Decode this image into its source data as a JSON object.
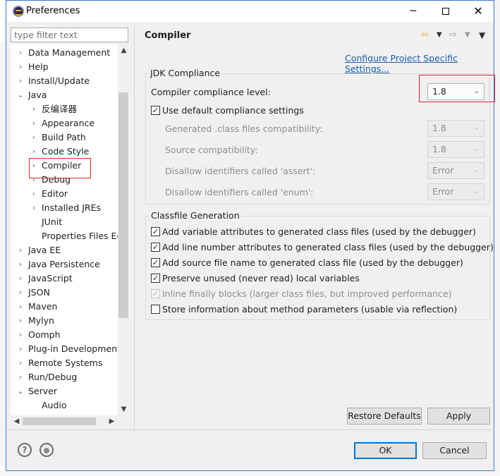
{
  "window": {
    "title": "Preferences",
    "controls": {
      "minimize": "─",
      "close": "✕"
    }
  },
  "filter": {
    "placeholder": "type filter text"
  },
  "tree": {
    "items": [
      {
        "label": "Data Management",
        "expander": "›",
        "level": 0
      },
      {
        "label": "Help",
        "expander": "›",
        "level": 0
      },
      {
        "label": "Install/Update",
        "expander": "›",
        "level": 0
      },
      {
        "label": "Java",
        "expander": "⌄",
        "level": 0
      },
      {
        "label": "反编译器",
        "expander": "›",
        "level": 1
      },
      {
        "label": "Appearance",
        "expander": "›",
        "level": 1
      },
      {
        "label": "Build Path",
        "expander": "›",
        "level": 1
      },
      {
        "label": "Code Style",
        "expander": "›",
        "level": 1
      },
      {
        "label": "Compiler",
        "expander": "›",
        "level": 1,
        "selected": true
      },
      {
        "label": "Debug",
        "expander": "›",
        "level": 1
      },
      {
        "label": "Editor",
        "expander": "›",
        "level": 1
      },
      {
        "label": "Installed JREs",
        "expander": "›",
        "level": 1
      },
      {
        "label": "JUnit",
        "expander": "",
        "level": 1
      },
      {
        "label": "Properties Files Ed",
        "expander": "",
        "level": 1
      },
      {
        "label": "Java EE",
        "expander": "›",
        "level": 0
      },
      {
        "label": "Java Persistence",
        "expander": "›",
        "level": 0
      },
      {
        "label": "JavaScript",
        "expander": "›",
        "level": 0
      },
      {
        "label": "JSON",
        "expander": "›",
        "level": 0
      },
      {
        "label": "Maven",
        "expander": "›",
        "level": 0
      },
      {
        "label": "Mylyn",
        "expander": "›",
        "level": 0
      },
      {
        "label": "Oomph",
        "expander": "›",
        "level": 0
      },
      {
        "label": "Plug-in Development",
        "expander": "›",
        "level": 0
      },
      {
        "label": "Remote Systems",
        "expander": "›",
        "level": 0
      },
      {
        "label": "Run/Debug",
        "expander": "›",
        "level": 0
      },
      {
        "label": "Server",
        "expander": "⌄",
        "level": 0
      },
      {
        "label": "Audio",
        "expander": "",
        "level": 1
      }
    ]
  },
  "page": {
    "title": "Compiler",
    "configure_link": "Configure Project Specific Settings...",
    "jdk_group": {
      "legend": "JDK Compliance",
      "compliance_label": "Compiler compliance level:",
      "compliance_value": "1.8",
      "use_default_label": "Use default compliance settings",
      "use_default_checked": "✓",
      "generated_label": "Generated .class files compatibility:",
      "generated_value": "1.8",
      "source_label": "Source compatibility:",
      "source_value": "1.8",
      "assert_label": "Disallow identifiers called 'assert':",
      "assert_value": "Error",
      "enum_label": "Disallow identifiers called 'enum':",
      "enum_value": "Error"
    },
    "classfile_group": {
      "legend": "Classfile Generation",
      "options": [
        {
          "label": "Add variable attributes to generated class files (used by the debugger)",
          "mark": "✓",
          "enabled": true
        },
        {
          "label": "Add line number attributes to generated class files (used by the debugger)",
          "mark": "✓",
          "enabled": true
        },
        {
          "label": "Add source file name to generated class file (used by the debugger)",
          "mark": "✓",
          "enabled": true
        },
        {
          "label": "Preserve unused (never read) local variables",
          "mark": "✓",
          "enabled": true
        },
        {
          "label": "Inline finally blocks (larger class files, but improved performance)",
          "mark": "✓",
          "enabled": false
        },
        {
          "label": "Store information about method parameters (usable via reflection)",
          "mark": "",
          "enabled": true
        }
      ]
    },
    "restore_defaults": "Restore Defaults",
    "apply": "Apply"
  },
  "footer": {
    "help_glyph": "?",
    "ok": "OK",
    "cancel": "Cancel"
  },
  "colors": {
    "selection_highlight": "#d9262c",
    "link": "#1a5fb4",
    "back_arrow": "#e8a53b",
    "default_button_border": "#0078d7"
  }
}
